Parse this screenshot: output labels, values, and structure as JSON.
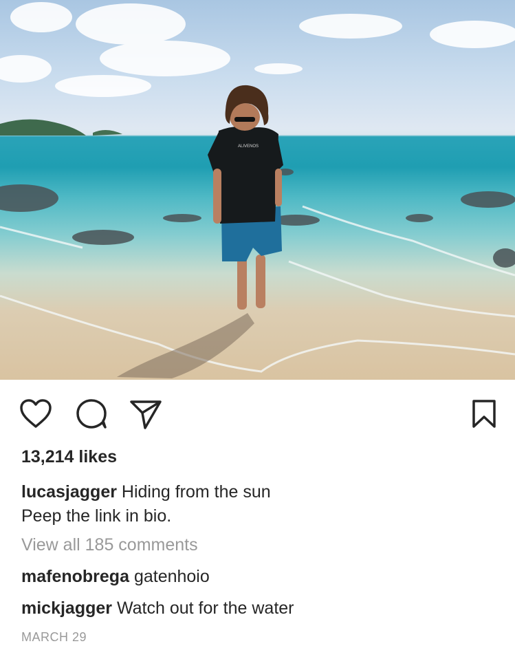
{
  "post": {
    "likes": "13,214 likes",
    "caption": {
      "username": "lucasjagger",
      "text_line1": "Hiding from the sun",
      "text_line2": "Peep the link in bio."
    },
    "view_all_comments": "View all 185 comments",
    "comments": [
      {
        "username": "mafenobrega",
        "text": "gatenhoio"
      },
      {
        "username": "mickjagger",
        "text": "Watch out for the water"
      }
    ],
    "date": "MARCH 29"
  },
  "photo": {
    "shirt_text": "ALIVENOS"
  },
  "icons": {
    "like": "heart-icon",
    "comment": "comment-bubble-icon",
    "share": "paper-plane-icon",
    "save": "bookmark-icon"
  },
  "colors": {
    "text": "#262626",
    "muted": "#999999",
    "background": "#ffffff"
  }
}
